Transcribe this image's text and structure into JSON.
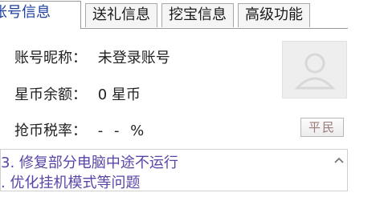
{
  "tabs": [
    {
      "label": "账号信息",
      "active": true
    },
    {
      "label": "送礼信息",
      "active": false
    },
    {
      "label": "挖宝信息",
      "active": false
    },
    {
      "label": "高级功能",
      "active": false
    }
  ],
  "account": {
    "nickname_label": "账号昵称：",
    "nickname_value": "未登录账号",
    "balance_label": "星币余额：",
    "balance_value": "0 星币",
    "rate_label": "抢币税率：",
    "rate_value": "- - %",
    "level_badge": "平民"
  },
  "news": {
    "lines": [
      "3. 修复部分电脑中途不运行",
      ". 优化挂机模式等问题"
    ]
  },
  "colors": {
    "active_tab_text": "#1f3f9f",
    "news_text": "#5a44a8",
    "badge_text": "#9b7a7a"
  },
  "icons": {
    "avatar": "user-silhouette-icon",
    "scroll": "chevron-up-icon"
  }
}
